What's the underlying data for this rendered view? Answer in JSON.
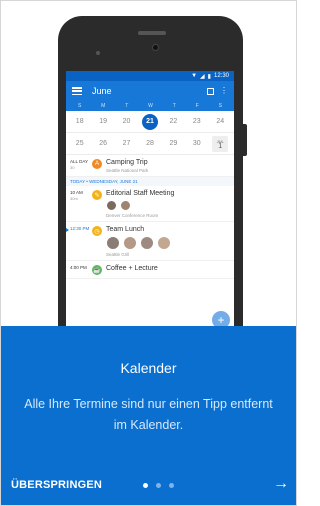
{
  "phone": {
    "status_time": "12:30",
    "app": {
      "month": "June",
      "weekdays": [
        "S",
        "M",
        "T",
        "W",
        "T",
        "F",
        "S"
      ],
      "week1": [
        "18",
        "19",
        "20",
        "21",
        "22",
        "23",
        "24"
      ],
      "week2": [
        "25",
        "26",
        "27",
        "28",
        "29",
        "30"
      ],
      "week2_last_month": "JUL",
      "week2_last_day": "1",
      "events": {
        "allday_label": "ALL DAY",
        "allday_sub": "30",
        "allday_title": "Camping Trip",
        "allday_location": "Seattle National Park",
        "section_header": "TODAY • WEDNESDAY, JUNE 21",
        "meeting_time": "10 AM",
        "meeting_duration": "30m",
        "meeting_title": "Editorial Staff Meeting",
        "meeting_location": "Denver Conference Room",
        "lunch_time": "12:30 PM",
        "lunch_title": "Team Lunch",
        "lunch_location": "Seattle Grill",
        "coffee_time": "4:00 PM",
        "coffee_title": "Coffee + Lecture"
      },
      "fab_label": "+"
    }
  },
  "panel": {
    "title": "Kalender",
    "description": "Alle Ihre Termine sind nur einen Tipp entfernt im Kalender.",
    "skip_label": "ÜBERSPRINGEN",
    "next_label": "→",
    "page_count": 3,
    "active_page": 1
  },
  "colors": {
    "brand_blue": "#0a6fcf",
    "appbar_blue": "#1778d8"
  }
}
